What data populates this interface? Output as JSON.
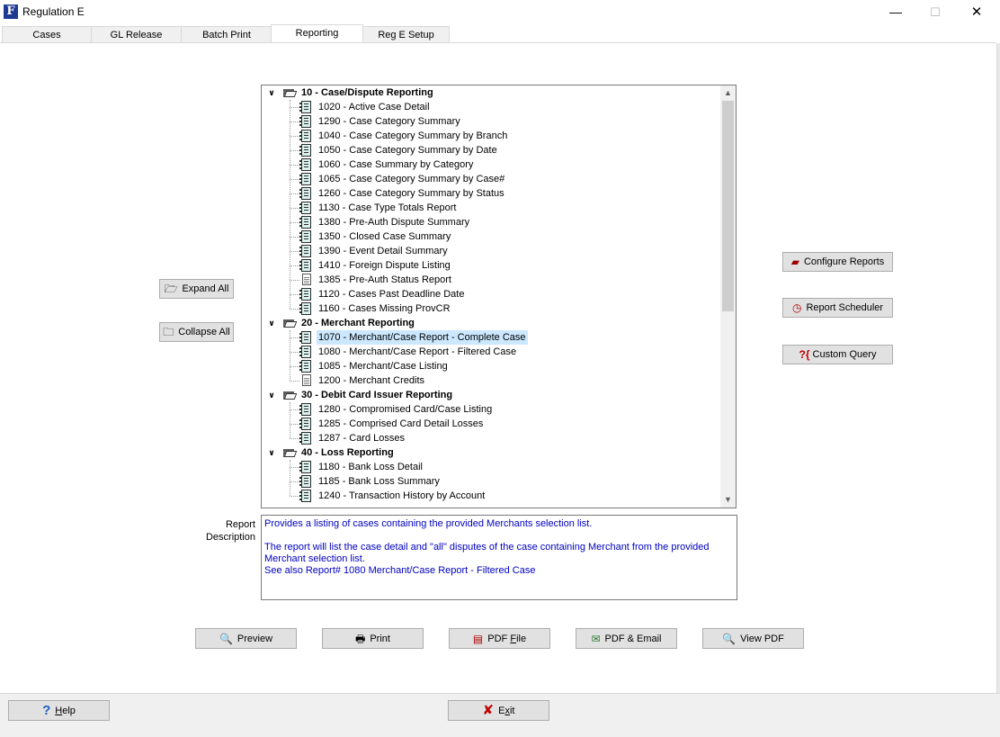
{
  "window": {
    "title": "Regulation E",
    "app_icon_letter": "F",
    "minimize_glyph": "—",
    "maximize_glyph": "☐",
    "close_glyph": "✕"
  },
  "tabs": [
    {
      "label": "Cases"
    },
    {
      "label": "GL Release"
    },
    {
      "label": "Batch Print"
    },
    {
      "label": "Reporting",
      "active": true
    },
    {
      "label": "Reg E Setup"
    }
  ],
  "left_buttons": {
    "expand_all": "Expand All",
    "collapse_all": "Collapse All"
  },
  "right_buttons": {
    "configure_reports": "Configure Reports",
    "report_scheduler": "Report Scheduler",
    "custom_query": "Custom Query"
  },
  "tree": {
    "groups": [
      {
        "label": "10 - Case/Dispute Reporting",
        "items": [
          {
            "label": "1020 - Active Case Detail",
            "icon": "report"
          },
          {
            "label": "1290 - Case Category Summary",
            "icon": "report"
          },
          {
            "label": "1040 - Case Category Summary by Branch",
            "icon": "report"
          },
          {
            "label": "1050 - Case Category Summary by Date",
            "icon": "report"
          },
          {
            "label": "1060 - Case Summary by Category",
            "icon": "report"
          },
          {
            "label": "1065 - Case Category Summary by Case#",
            "icon": "report"
          },
          {
            "label": "1260 - Case Category Summary by Status",
            "icon": "report"
          },
          {
            "label": "1130 - Case Type Totals Report",
            "icon": "report"
          },
          {
            "label": "1380 - Pre-Auth Dispute Summary",
            "icon": "report"
          },
          {
            "label": "1350 - Closed Case Summary",
            "icon": "report"
          },
          {
            "label": "1390 - Event Detail Summary",
            "icon": "report"
          },
          {
            "label": "1410 - Foreign Dispute Listing",
            "icon": "report"
          },
          {
            "label": "1385 - Pre-Auth Status Report",
            "icon": "document"
          },
          {
            "label": "1120 - Cases Past Deadline Date",
            "icon": "report"
          },
          {
            "label": "1160 - Cases Missing ProvCR",
            "icon": "report"
          }
        ]
      },
      {
        "label": "20 - Merchant Reporting",
        "items": [
          {
            "label": "1070 - Merchant/Case Report - Complete Case",
            "icon": "report",
            "selected": true
          },
          {
            "label": "1080 - Merchant/Case Report - Filtered Case",
            "icon": "report"
          },
          {
            "label": "1085 - Merchant/Case Listing",
            "icon": "report"
          },
          {
            "label": "1200 - Merchant Credits",
            "icon": "document"
          }
        ]
      },
      {
        "label": "30 - Debit Card Issuer Reporting",
        "items": [
          {
            "label": "1280 - Compromised Card/Case Listing",
            "icon": "report"
          },
          {
            "label": "1285 - Comprised Card Detail Losses",
            "icon": "report"
          },
          {
            "label": "1287 - Card Losses",
            "icon": "report"
          }
        ]
      },
      {
        "label": "40 - Loss Reporting",
        "items": [
          {
            "label": "1180 - Bank Loss Detail",
            "icon": "report"
          },
          {
            "label": "1185 - Bank Loss Summary",
            "icon": "report"
          },
          {
            "label": "1240 - Transaction History by Account",
            "icon": "report"
          }
        ]
      }
    ]
  },
  "description": {
    "label_line1": "Report",
    "label_line2": "Description",
    "line1": "Provides a listing of cases containing the provided Merchants selection list.",
    "line2": "The report will list the case detail and \"all\" disputes of the case containing Merchant from the provided Merchant selection list.",
    "line3": "See also Report# 1080 Merchant/Case Report - Filtered Case"
  },
  "action_buttons": {
    "preview": "Preview",
    "print": "Print",
    "pdf_file_prefix": "PDF ",
    "pdf_file_mnemonic": "F",
    "pdf_file_suffix": "ile",
    "pdf_email": "PDF & Email",
    "view_pdf": "View PDF"
  },
  "footer": {
    "help_mnemonic": "H",
    "help_suffix": "elp",
    "exit_prefix": "E",
    "exit_mnemonic": "x",
    "exit_suffix": "it"
  },
  "colors": {
    "description_text": "#0000c0",
    "selection": "#cce8ff",
    "exit_icon": "#c00000",
    "help_icon": "#1f5fbf"
  }
}
